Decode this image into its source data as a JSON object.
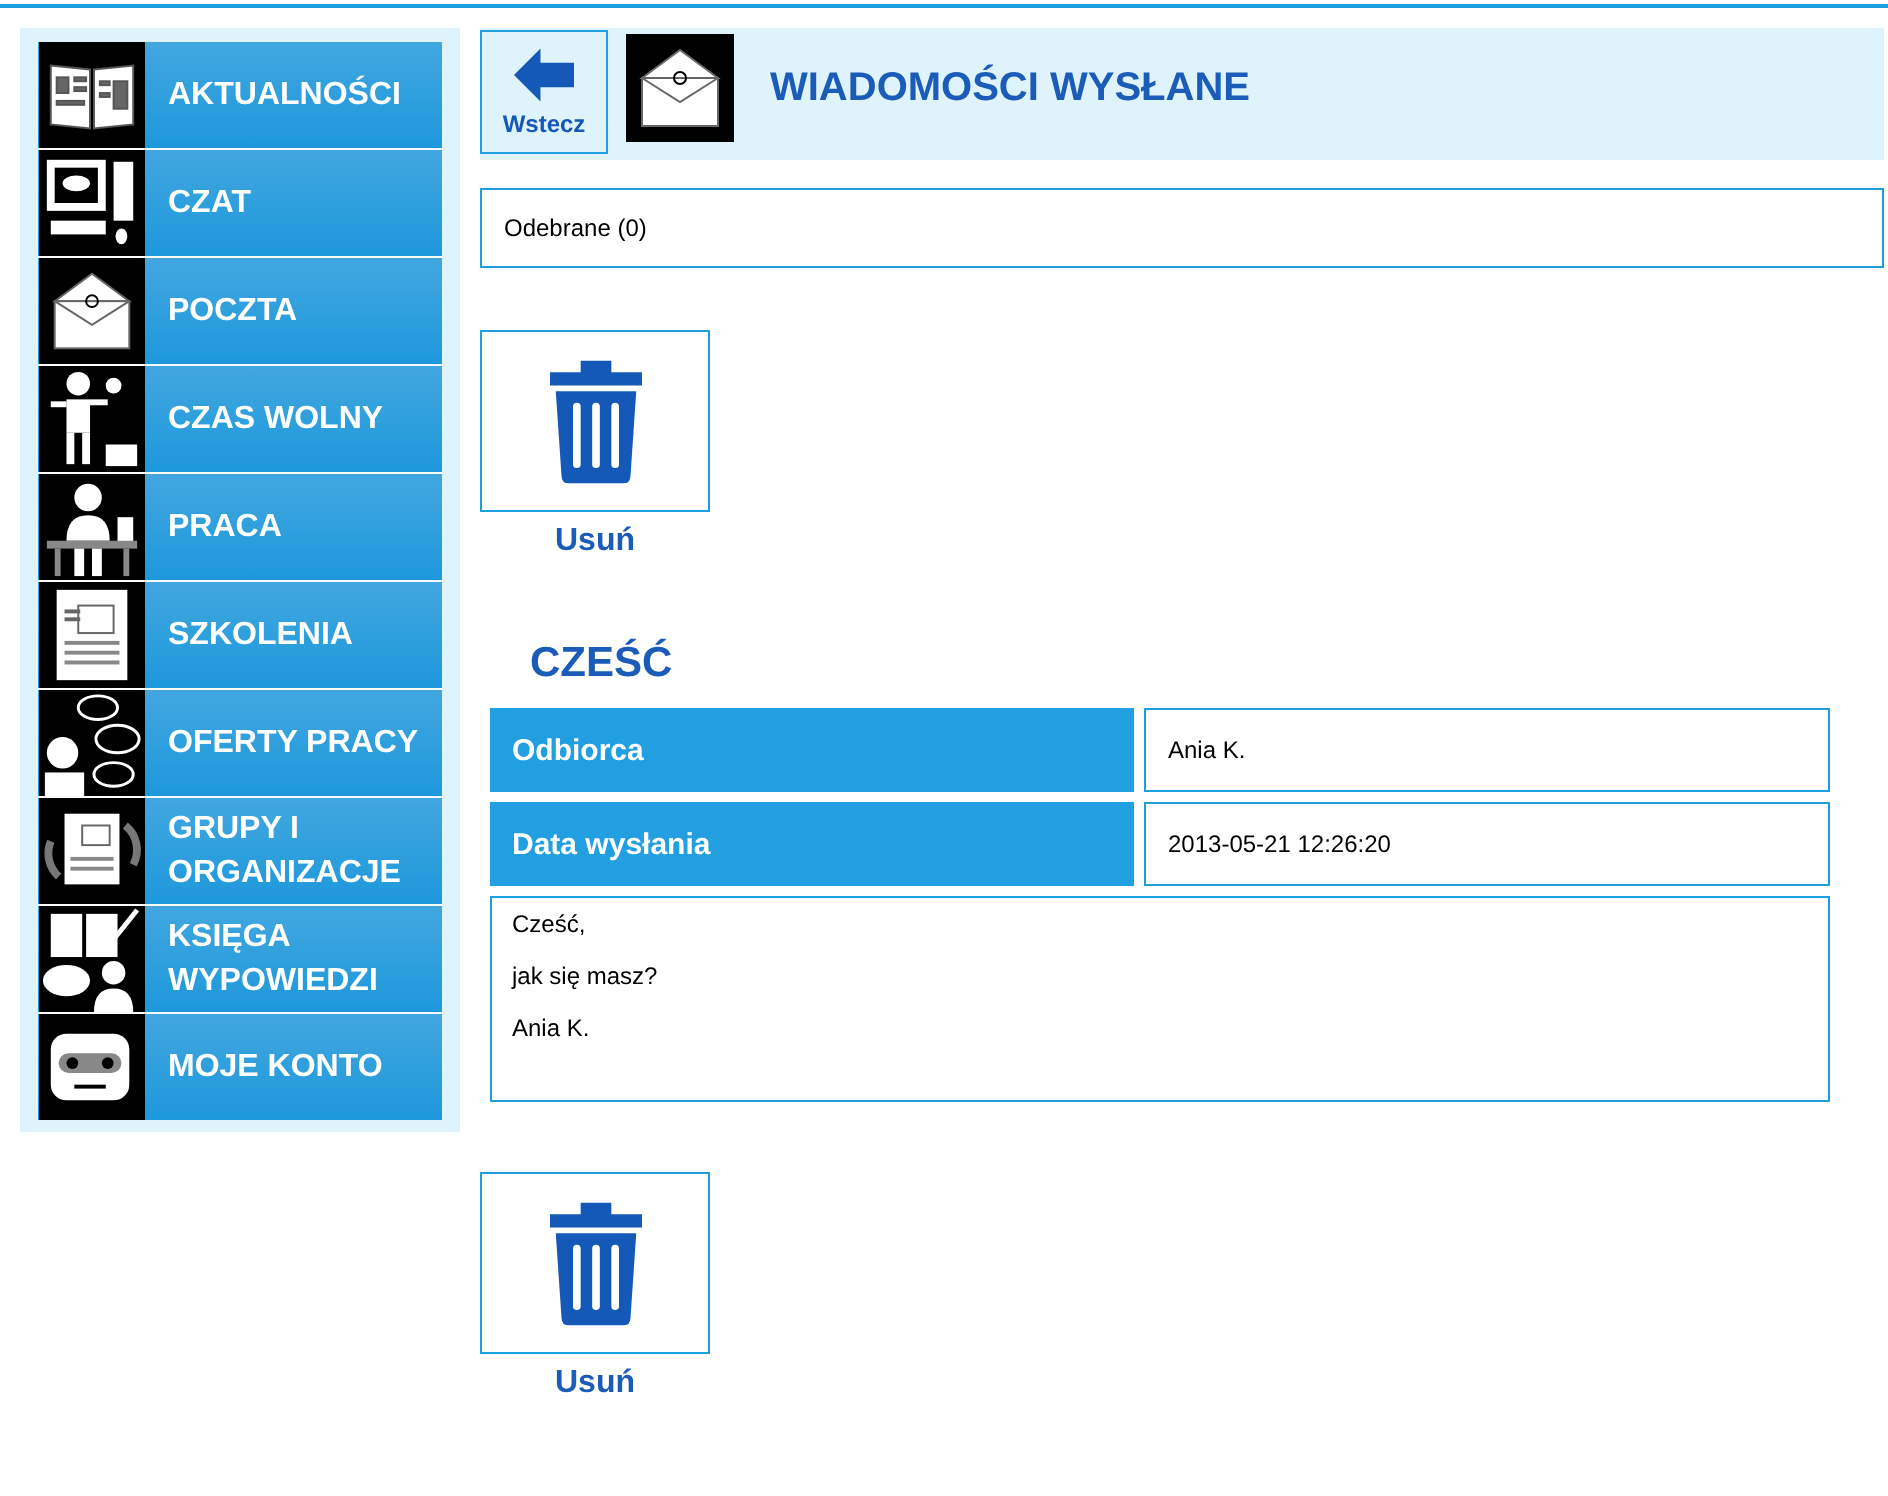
{
  "sidebar": {
    "items": [
      {
        "label": "AKTUALNOŚCI"
      },
      {
        "label": "CZAT"
      },
      {
        "label": "POCZTA"
      },
      {
        "label": "CZAS WOLNY"
      },
      {
        "label": "PRACA"
      },
      {
        "label": "SZKOLENIA"
      },
      {
        "label": "OFERTY PRACY"
      },
      {
        "label": "GRUPY I ORGANIZACJE"
      },
      {
        "label": "KSIĘGA WYPOWIEDZI"
      },
      {
        "label": "MOJE KONTO"
      }
    ]
  },
  "header": {
    "back_button": "Wstecz",
    "title": "WIADOMOŚCI WYSŁANE"
  },
  "inbox_link": "Odebrane (0)",
  "top_actions": {
    "delete": "Usuń"
  },
  "message": {
    "subject": "CZEŚĆ",
    "fields": [
      {
        "label": "Odbiorca",
        "value": "Ania K."
      },
      {
        "label": "Data wysłania",
        "value": "2013-05-21 12:26:20"
      }
    ],
    "body": [
      "Cześć,",
      "jak się masz?",
      "Ania K."
    ]
  },
  "bottom_actions": {
    "delete": "Usuń"
  }
}
